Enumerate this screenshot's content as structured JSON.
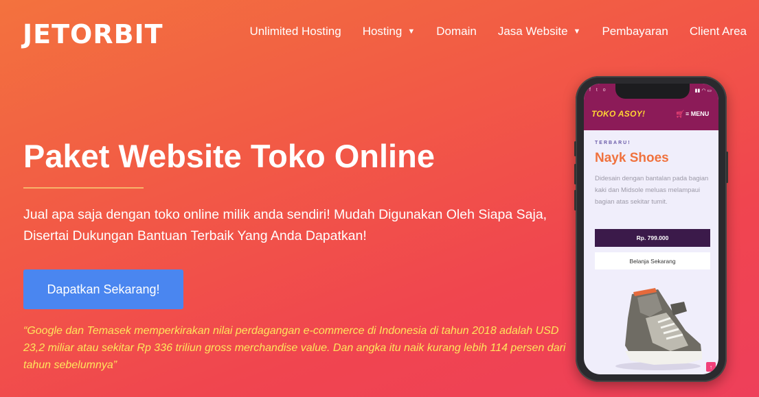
{
  "header": {
    "logo": "JETORBIT",
    "nav": [
      {
        "label": "Unlimited Hosting",
        "dropdown": false
      },
      {
        "label": "Hosting",
        "dropdown": true
      },
      {
        "label": "Domain",
        "dropdown": false
      },
      {
        "label": "Jasa Website",
        "dropdown": true
      },
      {
        "label": "Pembayaran",
        "dropdown": false
      },
      {
        "label": "Client Area",
        "dropdown": false
      }
    ]
  },
  "hero": {
    "title": "Paket Website Toko Online",
    "subtitle": "Jual apa saja dengan toko online milik anda sendiri! Mudah Digunakan Oleh Siapa Saja, Disertai Dukungan Bantuan Terbaik Yang Anda Dapatkan!",
    "cta_label": "Dapatkan Sekarang!",
    "quote": "“Google dan Temasek memperkirakan nilai perdagangan e-commerce di Indonesia di  tahun 2018 adalah USD 23,2 miliar atau sekitar Rp 336 triliun gross merchandise value. Dan angka itu naik kurang lebih 114 persen dari tahun sebelumnya”"
  },
  "phone": {
    "app_logo": "TOKO ASOY!",
    "menu_label": "MENU",
    "product_tag": "TERBARU!",
    "product_name": "Nayk Shoes",
    "product_desc": "Didesain dengan bantalan pada bagian kaki dan Midsole meluas melampaui bagian atas sekitar tumit.",
    "price": "Rp. 799.000",
    "buy_label": "Belanja Sekarang"
  },
  "colors": {
    "gradient_start": "#f3723e",
    "gradient_end": "#ee3f5a",
    "cta": "#4a86f0",
    "quote": "#ffe65c",
    "app_bar": "#8c1b58"
  },
  "icons": [
    "chevron-down-icon",
    "cart-icon",
    "hamburger-icon",
    "arrow-up-icon"
  ]
}
